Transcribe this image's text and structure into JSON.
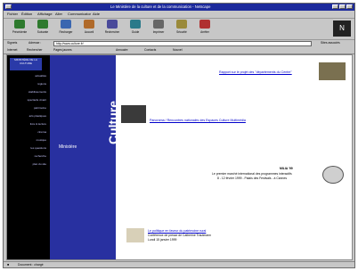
{
  "window": {
    "title": "Le Ministère de la culture et de la communication - Netscape"
  },
  "menu": [
    "Fichier",
    "Édition",
    "Affichage",
    "Aller",
    "Communicator",
    "Aide"
  ],
  "toolbar": [
    {
      "label": "Précédente",
      "icon": "back-arrow-icon"
    },
    {
      "label": "Suivante",
      "icon": "forward-arrow-icon"
    },
    {
      "label": "Recharger",
      "icon": "reload-icon"
    },
    {
      "label": "Accueil",
      "icon": "home-icon"
    },
    {
      "label": "Rechercher",
      "icon": "search-icon"
    },
    {
      "label": "Guide",
      "icon": "guide-icon"
    },
    {
      "label": "Imprimer",
      "icon": "print-icon"
    },
    {
      "label": "Sécurité",
      "icon": "lock-icon"
    },
    {
      "label": "Arrêter",
      "icon": "stop-icon"
    }
  ],
  "address": {
    "bookmarks_label": "Signets",
    "location_label": "Adresse :",
    "url": "http://www.culture.fr/",
    "related_label": "Sites associés"
  },
  "personal": [
    "Internet",
    "Rechercher",
    "Pages jaunes",
    "Annuaire",
    "Contacts",
    "Nouvel"
  ],
  "sidebar": {
    "logo_text": "MINISTÈRE DE LA CULTURE",
    "items": [
      "actualités",
      "régions",
      "établissements",
      "spectacle vivant",
      "patrimoine",
      "arts plastiques",
      "livre & lecture",
      "cinéma",
      "musique",
      "les questions",
      "recherche",
      "plan du site"
    ]
  },
  "vertical_title_line1": "Culture",
  "vertical_title_line2": "communication",
  "ministere": "Ministère",
  "links": {
    "top_right": "Rapport sur le projet des \"départements du Centre\"",
    "middle": "Panorama / Rencontres nationales des Espaces Culture Multimédia",
    "mila_title": "MILIA '99",
    "mila_desc1": "Le premier marché international des programmes interactifs",
    "mila_desc2": "8 - 12 février 1999 - Palais des Festivals - à Cannes",
    "bottom1": "Le politique en faveur du patrimoine rural",
    "bottom2": "Conférence de presse de Catherine Trautmann",
    "bottom3": "Lundi 15 janvier 1999"
  },
  "status": {
    "text": "Document : chargé"
  },
  "colors": {
    "accent": "#2830a0",
    "nav_bg": "#000000",
    "titlebar": "#1c2a9c"
  }
}
